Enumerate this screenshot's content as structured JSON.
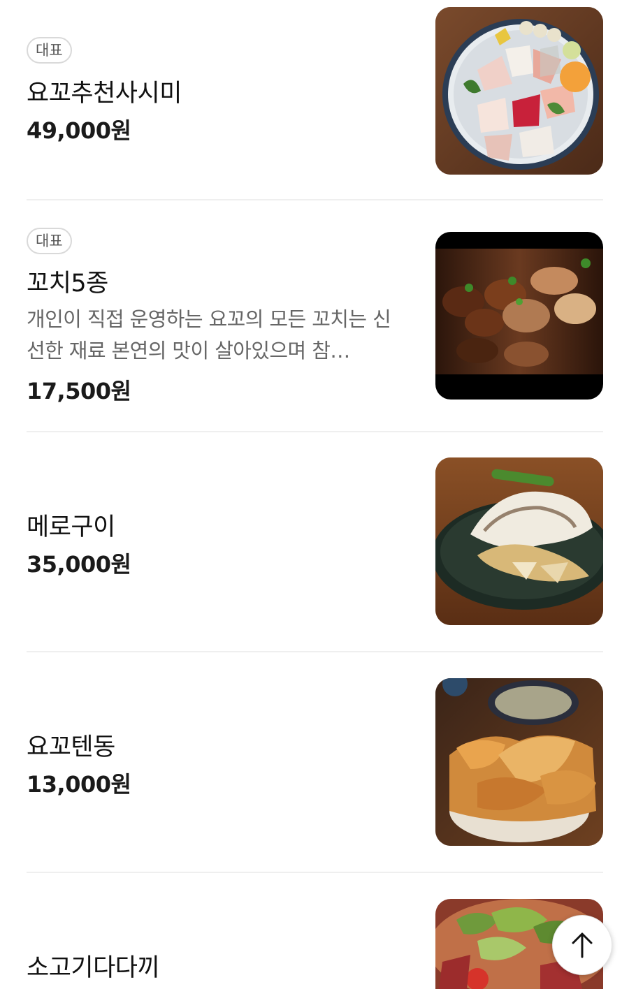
{
  "menu": {
    "items": [
      {
        "badge": "대표",
        "name": "요꼬추천사시미",
        "description": "",
        "price": "49,000원",
        "photo_icon": "sashimi-platter-photo"
      },
      {
        "badge": "대표",
        "name": "꼬치5종",
        "description": "개인이 직접 운영하는 요꼬의 모든 꼬치는 신선한 재료 본연의 맛이 살아있으며 참…",
        "price": "17,500원",
        "photo_icon": "skewers-photo"
      },
      {
        "badge": "",
        "name": "메로구이",
        "description": "",
        "price": "35,000원",
        "photo_icon": "grilled-fish-photo"
      },
      {
        "badge": "",
        "name": "요꼬텐동",
        "description": "",
        "price": "13,000원",
        "photo_icon": "tempura-bowl-photo"
      },
      {
        "badge": "",
        "name": "소고기다다끼",
        "description": "",
        "price": "",
        "photo_icon": "beef-tataki-salad-photo"
      }
    ]
  },
  "scroll_top_icon": "arrow-up-icon",
  "colors": {
    "divider": "#efefef",
    "badge_border": "#d9d9d9",
    "text_primary": "#111111",
    "text_secondary": "#666666"
  }
}
